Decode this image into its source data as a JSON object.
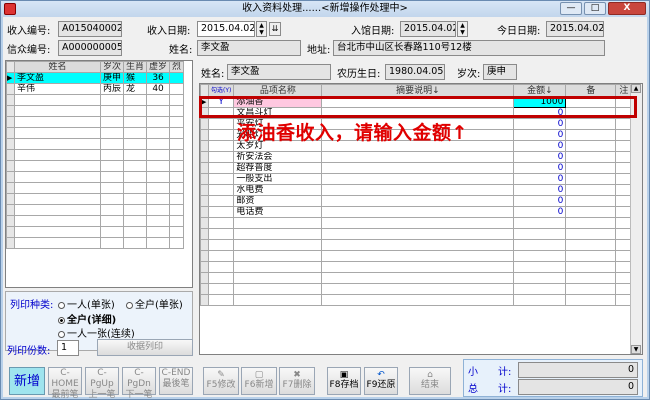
{
  "window": {
    "title": "收入资料处理......<新增操作处理中>",
    "close": "X",
    "min": "—",
    "max": "□"
  },
  "header": {
    "receipt_no_label": "收入编号:",
    "receipt_no": "A015040002",
    "income_date_label": "收入日期:",
    "income_date": "2015.04.02",
    "entry_date_label": "入馆日期:",
    "entry_date": "2015.04.02",
    "today_label": "今日日期:",
    "today": "2015.04.02",
    "believer_no_label": "信众编号:",
    "believer_no": "A000000005",
    "name_label": "姓名:",
    "name": "李文盈",
    "addr_label": "地址:",
    "addr": "台北市中山区长春路110号12楼"
  },
  "left_table": {
    "headers": [
      "姓名",
      "岁次",
      "生肖",
      "虚岁",
      "烈"
    ],
    "rows": [
      {
        "name": "李文盈",
        "year": "庚申",
        "zodiac": "猴",
        "age": "36",
        "x": ""
      },
      {
        "name": "辛伟",
        "year": "丙辰",
        "zodiac": "龙",
        "age": "40",
        "x": ""
      }
    ]
  },
  "right_header": {
    "name_label": "姓名:",
    "name": "李文盈",
    "birth_label": "农历生日:",
    "birth": "1980.04.05",
    "year_label": "岁次:",
    "year": "庚申"
  },
  "right_table": {
    "headers": [
      "勾选(Y)",
      "品项名称",
      "摘要说明↓",
      "金额↓",
      "备",
      "注"
    ],
    "rows": [
      {
        "chk": "Y",
        "item": "添油香",
        "memo": "",
        "amt": "1000"
      },
      {
        "chk": "",
        "item": "文昌斗灯",
        "memo": "",
        "amt": "0"
      },
      {
        "chk": "",
        "item": "平安灯",
        "memo": "",
        "amt": "0"
      },
      {
        "chk": "",
        "item": "光明灯",
        "memo": "",
        "amt": "0"
      },
      {
        "chk": "",
        "item": "太岁灯",
        "memo": "",
        "amt": "0"
      },
      {
        "chk": "",
        "item": "祈安法会",
        "memo": "",
        "amt": "0"
      },
      {
        "chk": "",
        "item": "超荐普度",
        "memo": "",
        "amt": "0"
      },
      {
        "chk": "",
        "item": "一般支出",
        "memo": "",
        "amt": "0"
      },
      {
        "chk": "",
        "item": "水电费",
        "memo": "",
        "amt": "0"
      },
      {
        "chk": "",
        "item": "邮资",
        "memo": "",
        "amt": "0"
      },
      {
        "chk": "",
        "item": "电话费",
        "memo": "",
        "amt": "0"
      }
    ]
  },
  "annotation": "添油香收入，请输入金额↑",
  "print": {
    "type_label": "列印种类:",
    "opt1": "一人(单张)",
    "opt2": "全户(单张)",
    "opt3": "全户(详细)",
    "opt4": "一人一张(连续)",
    "copies_label": "列印份数:",
    "copies": "1",
    "print_btn": "收据列印"
  },
  "buttons": [
    {
      "key": "新增",
      "label": ""
    },
    {
      "key": "C-HOME",
      "label": "最前笔"
    },
    {
      "key": "C-PgUp",
      "label": "上一笔"
    },
    {
      "key": "C-PgDn",
      "label": "下一笔"
    },
    {
      "key": "C-END",
      "label": "最後笔"
    },
    {
      "key": "F5修改",
      "label": ""
    },
    {
      "key": "F6新增",
      "label": ""
    },
    {
      "key": "F7删除",
      "label": ""
    },
    {
      "key": "F8存档",
      "label": ""
    },
    {
      "key": "F9还原",
      "label": ""
    },
    {
      "key": "结束",
      "label": ""
    }
  ],
  "totals": {
    "small_label": "小　　计:",
    "small": "0",
    "total_label": "总　　计:",
    "total": "0"
  }
}
